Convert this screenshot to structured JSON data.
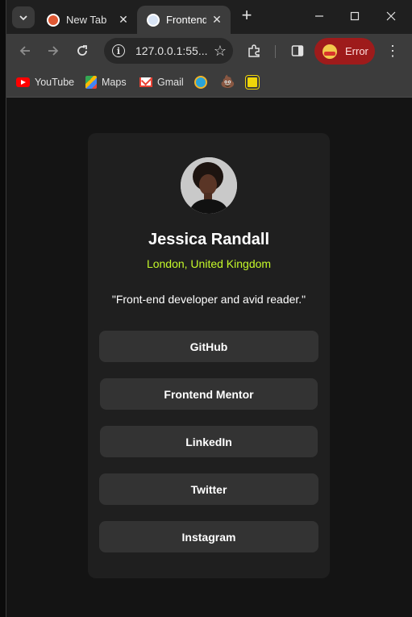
{
  "browser": {
    "tabs": [
      {
        "title": "New Tab",
        "favicon": "duckduckgo-icon"
      },
      {
        "title": "Frontend",
        "favicon": "globe-icon"
      }
    ],
    "address": "127.0.0.1:55...",
    "profile_status": "Error",
    "bookmarks": [
      {
        "label": "YouTube",
        "icon": "youtube-icon"
      },
      {
        "label": "Maps",
        "icon": "maps-icon"
      },
      {
        "label": "Gmail",
        "icon": "gmail-icon"
      },
      {
        "label": "",
        "icon": "extension-blue-icon"
      },
      {
        "label": "",
        "icon": "poop-emoji-icon"
      },
      {
        "label": "",
        "icon": "yellow-grid-icon"
      }
    ]
  },
  "profile": {
    "name": "Jessica Randall",
    "location": "London, United Kingdom",
    "bio": "\"Front-end developer and avid reader.\"",
    "links": [
      "GitHub",
      "Frontend Mentor",
      "LinkedIn",
      "Twitter",
      "Instagram"
    ]
  },
  "colors": {
    "accent": "#c4f82a",
    "card": "#1f1f1f",
    "button": "#333333",
    "page": "#141414",
    "error_pill": "#9e1b1b"
  }
}
